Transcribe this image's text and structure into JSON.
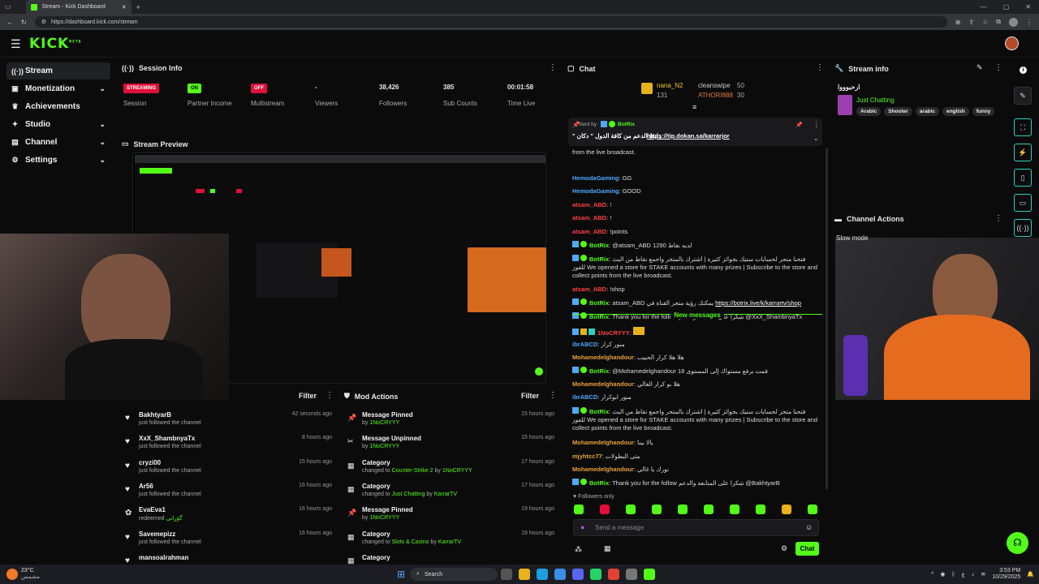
{
  "browser": {
    "tab_title": "Stream - Kick Dashboard",
    "url": "https://dashboard.kick.com/stream"
  },
  "header": {
    "logo": "KICK",
    "logo_sup": "BETA"
  },
  "sidebar": {
    "items": [
      {
        "label": "Stream"
      },
      {
        "label": "Monetization"
      },
      {
        "label": "Achievements"
      },
      {
        "label": "Studio"
      },
      {
        "label": "Channel"
      },
      {
        "label": "Settings"
      }
    ]
  },
  "session": {
    "title": "Session Info",
    "stats": [
      {
        "value": "STREAMING",
        "label": "Session",
        "kind": "badge",
        "color": "#e0103a"
      },
      {
        "value": "ON",
        "label": "Partner Income",
        "kind": "badge",
        "color": "#53fc18"
      },
      {
        "value": "OFF",
        "label": "Multistream",
        "kind": "badge",
        "color": "#e0103a"
      },
      {
        "value": "-",
        "label": "Viewers"
      },
      {
        "value": "38,426",
        "label": "Followers"
      },
      {
        "value": "385",
        "label": "Sub Counts"
      },
      {
        "value": "00:01:58",
        "label": "Time Live"
      }
    ]
  },
  "preview": {
    "title": "Stream Preview"
  },
  "activity": {
    "filter_label": "Filter",
    "items": [
      {
        "name": "BakhtyarB",
        "sub": "just followed the channel",
        "time": "42 seconds ago"
      },
      {
        "name": "XxX_ShambnyaTx",
        "sub": "just followed the channel",
        "time": "8 hours ago"
      },
      {
        "name": "cryzi00",
        "sub": "just followed the channel",
        "time": "15 hours ago"
      },
      {
        "name": "Ar56",
        "sub": "just followed the channel",
        "time": "16 hours ago"
      },
      {
        "name": "EvaEva1",
        "sub": "redeemed",
        "sub2": "گۆرانی",
        "time": "16 hours ago"
      },
      {
        "name": "Savemepizz",
        "sub": "just followed the channel",
        "time": "16 hours ago"
      },
      {
        "name": "mansoalrahman",
        "sub": "",
        "time": ""
      }
    ]
  },
  "mod": {
    "title": "Mod Actions",
    "filter_label": "Filter",
    "items": [
      {
        "name": "Message Pinned",
        "sub": "by",
        "who": "1NoCRYYY",
        "time": "15 hours ago"
      },
      {
        "name": "Message Unpinned",
        "sub": "by",
        "who": "1NoCRYYY",
        "time": "15 hours ago"
      },
      {
        "name": "Category",
        "sub": "changed to",
        "what": "Counter-Strike 2",
        "by": "1NoCRYYY",
        "time": "17 hours ago"
      },
      {
        "name": "Category",
        "sub": "changed to",
        "what": "Just Chatting",
        "by": "KarrarTV",
        "time": "17 hours ago"
      },
      {
        "name": "Message Pinned",
        "sub": "by",
        "who": "1NoCRYYY",
        "time": "19 hours ago"
      },
      {
        "name": "Category",
        "sub": "changed to",
        "what": "Slots & Casino",
        "by": "KarrarTV",
        "time": "19 hours ago"
      },
      {
        "name": "Category",
        "sub": "",
        "time": ""
      }
    ]
  },
  "chat": {
    "title": "Chat",
    "leaders": [
      {
        "name": "nana_N2",
        "count": "131"
      },
      {
        "name": "cleanswipe",
        "count": "50"
      },
      {
        "name": "ATHORI888",
        "count": "30"
      }
    ],
    "pinned": {
      "sent_by": "Sent by",
      "user": "BotRix",
      "text": "\" رابط الدعم من كافة الدول \" دكان",
      "link": "https://tip.dokan.sa/karrarjor"
    },
    "partial_top": "from the live broadcast.",
    "lines": [
      {
        "user": "HemodaGaming",
        "color": "b",
        "text": "GG"
      },
      {
        "user": "HemodaGaming",
        "color": "b",
        "text": "GOOD"
      },
      {
        "user": "atsam_ABD",
        "color": "r",
        "text": "!"
      },
      {
        "user": "atsam_ABD",
        "color": "r",
        "text": "!"
      },
      {
        "user": "atsam_ABD",
        "color": "r",
        "text": "!points"
      },
      {
        "user": "BotRix",
        "color": "g",
        "text": "@atsam_ABD لديه نقاط 1290"
      },
      {
        "user": "BotRix",
        "color": "g",
        "text": "فتحنا متجر لحسابات ستيك بجوائز كثيرة | اشترك بالمتجر واجمع نقاط من البث للفوز We opened a store for STAKE accounts with many prizes | Subscribe to the store and collect points from the live broadcast."
      },
      {
        "user": "atsam_ABD",
        "color": "r",
        "text": "!shop"
      },
      {
        "user": "BotRix",
        "color": "g",
        "text": "atsam_ABD يمكنك رؤية متجر القناة في",
        "link": "https://botrix.live/k/karrartv/shop"
      },
      {
        "user": "BotRix",
        "color": "g",
        "text": "Thank you for the follow شكرا على المتابعة والدعم @XxX_ShambnyaTx"
      }
    ],
    "new_messages": "New messages",
    "lines2": [
      {
        "user": "1NoCRYYY",
        "color": "r",
        "text": ""
      },
      {
        "user": "ibrABCD",
        "color": "b",
        "text": "منور كرار"
      },
      {
        "user": "Mohamedelghandour",
        "color": "o",
        "text": "هلا هلا كرار الحبيب"
      },
      {
        "user": "BotRix",
        "color": "g",
        "text": "@Mohamedelghandour قمت برفع مستواك إلى المستوى 18"
      },
      {
        "user": "Mohamedelghandour",
        "color": "o",
        "text": "هلا بو كرار الغالي"
      },
      {
        "user": "ibrABCD",
        "color": "b",
        "text": "منور ابوكرار"
      },
      {
        "user": "BotRix",
        "color": "g",
        "text": "فتحنا متجر لحسابات ستيك بجوائز كثيرة | اشترك بالمتجر واجمع نقاط من البث للفوز We opened a store for STAKE accounts with many prizes | Subscribe to the store and collect points from the live broadcast."
      },
      {
        "user": "Mohamedelghandour",
        "color": "o",
        "text": "يالا بينا"
      },
      {
        "user": "mjyhtcc77",
        "color": "o",
        "text": "متى البطولات"
      },
      {
        "user": "Mohamedelghandour",
        "color": "o",
        "text": "نورك يا غالي"
      },
      {
        "user": "BotRix",
        "color": "g",
        "text": "Thank you for the follow شكرا على المتابعة والدعم @BakhtyarB"
      }
    ],
    "followers_only": "Followers only",
    "input_placeholder": "Send a message",
    "send_label": "Chat"
  },
  "stream_info": {
    "title": "Stream info",
    "stream_title": "ارحبوووا",
    "category": "Just Chatting",
    "tags": [
      "Arabic",
      "Shooter",
      "arabic",
      "english",
      "funny"
    ]
  },
  "channel_actions": {
    "title": "Channel Actions",
    "slow_mode": "Slow mode"
  },
  "taskbar": {
    "weather": "23°C",
    "weather_sub": "مشمس",
    "search": "Search",
    "time": "3:53 PM",
    "date": "10/29/2025"
  }
}
